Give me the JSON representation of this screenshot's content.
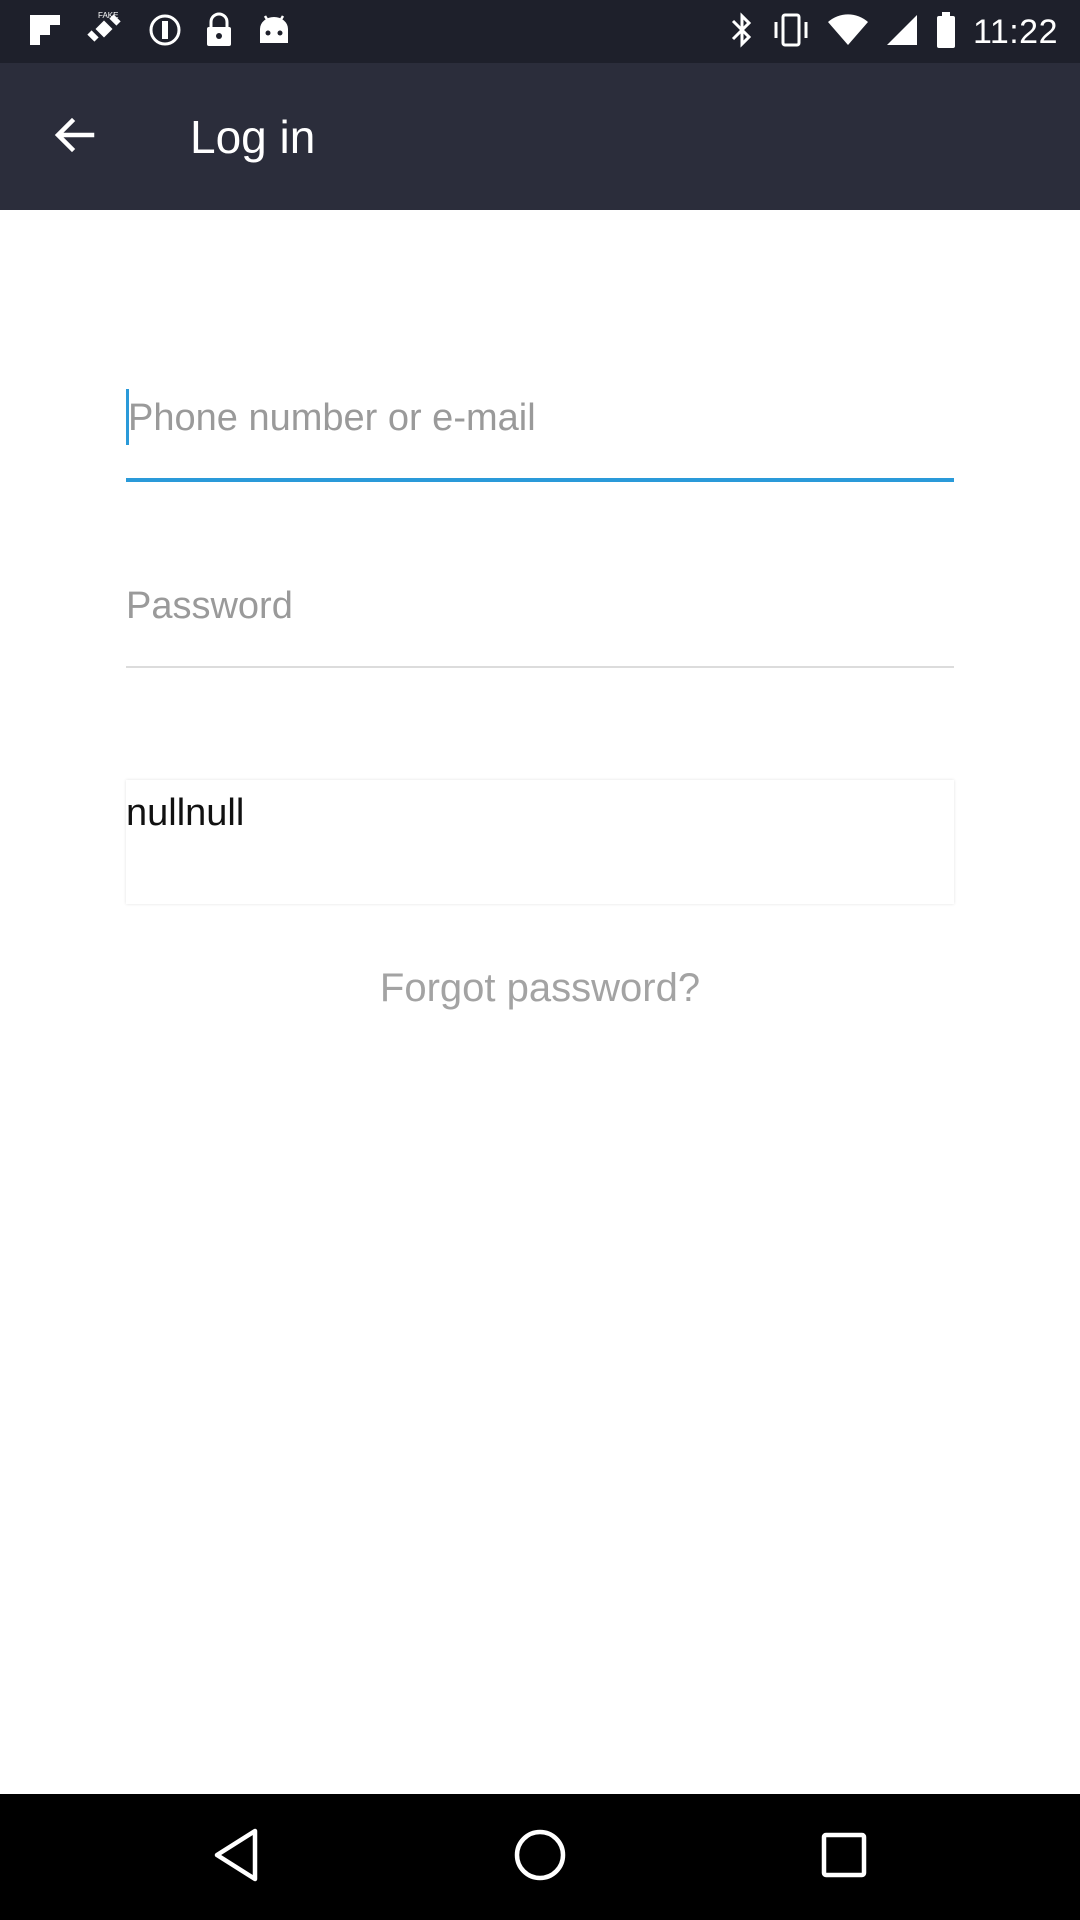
{
  "status_bar": {
    "time": "11:22",
    "left_icons": [
      "flipboard-icon",
      "fake-gps-icon",
      "alert-circle-icon",
      "lock-icon",
      "android-icon"
    ],
    "right_icons": [
      "bluetooth-icon",
      "vibrate-icon",
      "wifi-icon",
      "signal-icon",
      "battery-icon"
    ]
  },
  "app_bar": {
    "title": "Log in",
    "back_icon": "arrow-back-icon"
  },
  "form": {
    "email_placeholder": "Phone number or e-mail",
    "password_placeholder": "Password",
    "null_text": "nullnull",
    "forgot_password": "Forgot password?"
  },
  "colors": {
    "status_bar_bg": "#1e202b",
    "app_bar_bg": "#2b2d3b",
    "accent": "#2a9ad9",
    "link_gray": "#a3a3a3"
  },
  "nav_bar": {
    "buttons": [
      "nav-back-icon",
      "nav-home-icon",
      "nav-recents-icon"
    ]
  }
}
